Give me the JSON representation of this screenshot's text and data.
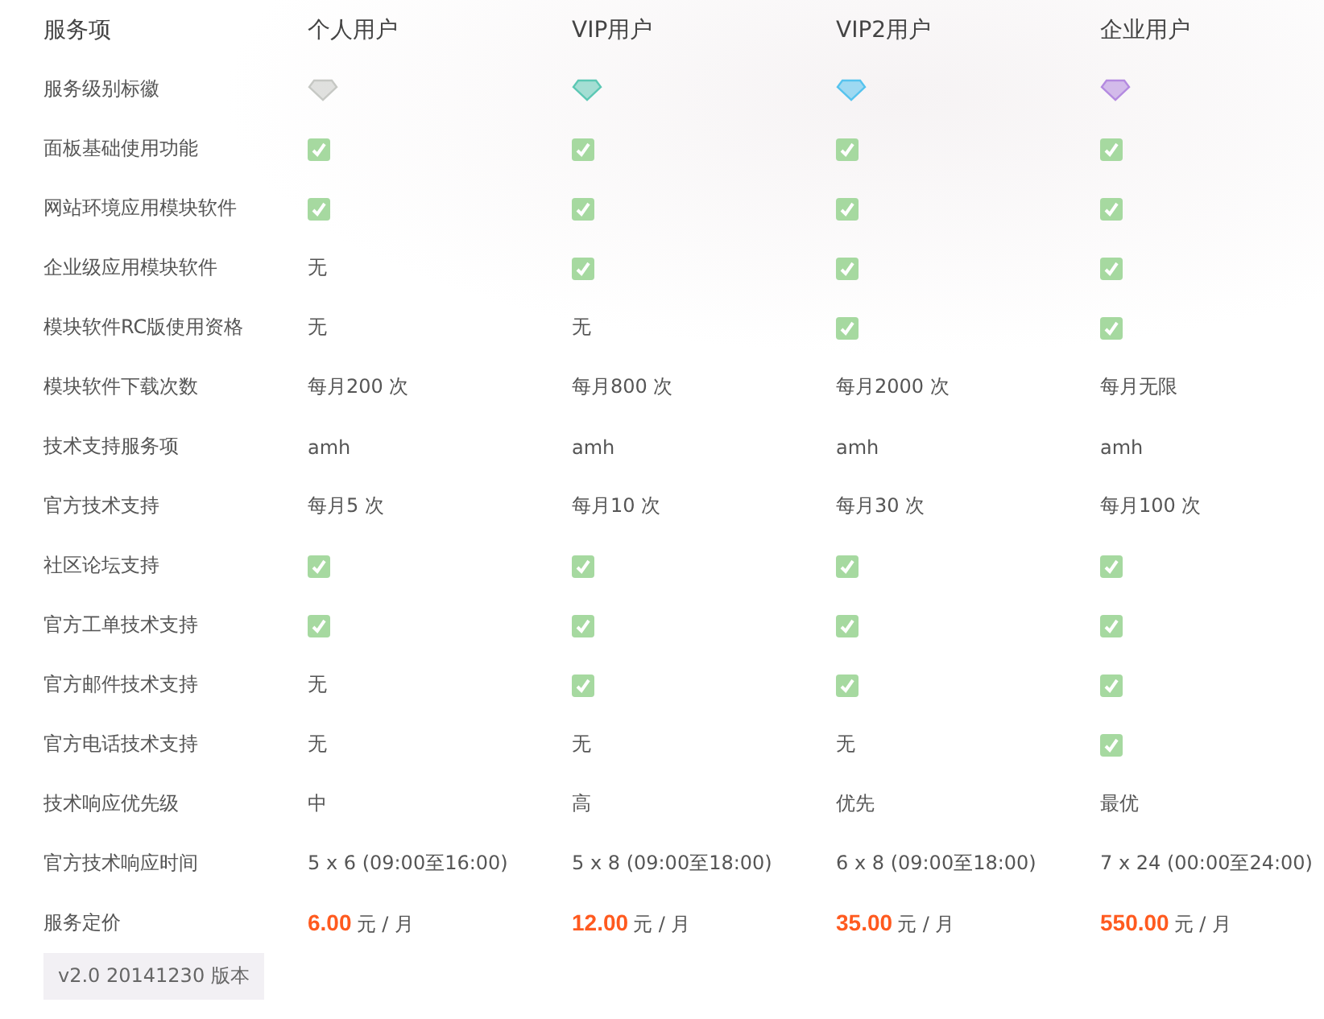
{
  "columns": [
    "服务项",
    "个人用户",
    "VIP用户",
    "VIP2用户",
    "企业用户"
  ],
  "rows": [
    {
      "label": "服务级别标徽",
      "cells": [
        {
          "kind": "diamond",
          "color": "#c6c8c4"
        },
        {
          "kind": "diamond",
          "color": "#5cc8b4"
        },
        {
          "kind": "diamond",
          "color": "#56c3ee"
        },
        {
          "kind": "diamond",
          "color": "#b48ae0"
        }
      ]
    },
    {
      "label": "面板基础使用功能",
      "cells": [
        {
          "kind": "check"
        },
        {
          "kind": "check"
        },
        {
          "kind": "check"
        },
        {
          "kind": "check"
        }
      ]
    },
    {
      "label": "网站环境应用模块软件",
      "cells": [
        {
          "kind": "check"
        },
        {
          "kind": "check"
        },
        {
          "kind": "check"
        },
        {
          "kind": "check"
        }
      ]
    },
    {
      "label": "企业级应用模块软件",
      "cells": [
        {
          "kind": "text",
          "text": "无"
        },
        {
          "kind": "check"
        },
        {
          "kind": "check"
        },
        {
          "kind": "check"
        }
      ]
    },
    {
      "label": "模块软件RC版使用资格",
      "cells": [
        {
          "kind": "text",
          "text": "无"
        },
        {
          "kind": "text",
          "text": "无"
        },
        {
          "kind": "check"
        },
        {
          "kind": "check"
        }
      ]
    },
    {
      "label": "模块软件下载次数",
      "cells": [
        {
          "kind": "text",
          "text": "每月200 次"
        },
        {
          "kind": "text",
          "text": "每月800 次"
        },
        {
          "kind": "text",
          "text": "每月2000 次"
        },
        {
          "kind": "text",
          "text": "每月无限"
        }
      ]
    },
    {
      "label": "技术支持服务项",
      "cells": [
        {
          "kind": "text",
          "text": "amh"
        },
        {
          "kind": "text",
          "text": "amh"
        },
        {
          "kind": "text",
          "text": "amh"
        },
        {
          "kind": "text",
          "text": "amh"
        }
      ]
    },
    {
      "label": "官方技术支持",
      "cells": [
        {
          "kind": "text",
          "text": "每月5 次"
        },
        {
          "kind": "text",
          "text": "每月10 次"
        },
        {
          "kind": "text",
          "text": "每月30 次"
        },
        {
          "kind": "text",
          "text": "每月100 次"
        }
      ]
    },
    {
      "label": "社区论坛支持",
      "cells": [
        {
          "kind": "check"
        },
        {
          "kind": "check"
        },
        {
          "kind": "check"
        },
        {
          "kind": "check"
        }
      ]
    },
    {
      "label": "官方工单技术支持",
      "cells": [
        {
          "kind": "check"
        },
        {
          "kind": "check"
        },
        {
          "kind": "check"
        },
        {
          "kind": "check"
        }
      ]
    },
    {
      "label": "官方邮件技术支持",
      "cells": [
        {
          "kind": "text",
          "text": "无"
        },
        {
          "kind": "check"
        },
        {
          "kind": "check"
        },
        {
          "kind": "check"
        }
      ]
    },
    {
      "label": "官方电话技术支持",
      "cells": [
        {
          "kind": "text",
          "text": "无"
        },
        {
          "kind": "text",
          "text": "无"
        },
        {
          "kind": "text",
          "text": "无"
        },
        {
          "kind": "check"
        }
      ]
    },
    {
      "label": "技术响应优先级",
      "cells": [
        {
          "kind": "text",
          "text": "中"
        },
        {
          "kind": "text",
          "text": "高"
        },
        {
          "kind": "text",
          "text": "优先"
        },
        {
          "kind": "text",
          "text": "最优"
        }
      ]
    },
    {
      "label": "官方技术响应时间",
      "cells": [
        {
          "kind": "text",
          "text": "5 x 6 (09:00至16:00)"
        },
        {
          "kind": "text",
          "text": "5 x 8 (09:00至18:00)"
        },
        {
          "kind": "text",
          "text": "6 x 8 (09:00至18:00)"
        },
        {
          "kind": "text",
          "text": "7 x 24 (00:00至24:00)"
        }
      ]
    },
    {
      "label": "服务定价",
      "cells": [
        {
          "kind": "price",
          "amount": "6.00",
          "unit": "元 / 月"
        },
        {
          "kind": "price",
          "amount": "12.00",
          "unit": "元 / 月"
        },
        {
          "kind": "price",
          "amount": "35.00",
          "unit": "元 / 月"
        },
        {
          "kind": "price",
          "amount": "550.00",
          "unit": "元 / 月"
        }
      ]
    }
  ],
  "version": "v2.0 20141230 版本"
}
